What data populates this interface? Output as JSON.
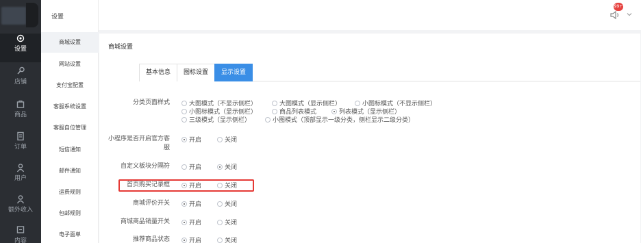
{
  "rail": {
    "items": [
      {
        "label": "设置",
        "icon": "gear-icon",
        "active": true
      },
      {
        "label": "店铺",
        "icon": "store-icon",
        "active": false
      },
      {
        "label": "商品",
        "icon": "bag-icon",
        "active": false
      },
      {
        "label": "订单",
        "icon": "order-icon",
        "active": false
      },
      {
        "label": "用户",
        "icon": "user-icon",
        "active": false
      },
      {
        "label": "额外收入",
        "icon": "income-icon",
        "active": false
      },
      {
        "label": "内容",
        "icon": "content-icon",
        "active": false
      }
    ]
  },
  "menu": {
    "header": "设置",
    "items": [
      {
        "label": "商城设置",
        "active": true
      },
      {
        "label": "网站设置",
        "active": false
      },
      {
        "label": "支付宝配置",
        "active": false
      },
      {
        "label": "客服系统设置",
        "active": false
      },
      {
        "label": "客服自位管理",
        "active": false
      },
      {
        "label": "短信通知",
        "active": false
      },
      {
        "label": "邮件通知",
        "active": false
      },
      {
        "label": "运费规则",
        "active": false
      },
      {
        "label": "包邮规则",
        "active": false
      },
      {
        "label": "电子面单",
        "active": false
      }
    ]
  },
  "topbar": {
    "badge": "99+"
  },
  "card": {
    "title": "商城设置",
    "tabs": [
      {
        "label": "基本信息",
        "active": false
      },
      {
        "label": "图标设置",
        "active": false
      },
      {
        "label": "显示设置",
        "active": true
      }
    ]
  },
  "settings": {
    "category_style": {
      "label": "分类页面样式",
      "options": [
        {
          "label": "大图模式（不显示侧栏）",
          "checked": false
        },
        {
          "label": "大图模式（显示侧栏）",
          "checked": false
        },
        {
          "label": "小图标模式（不显示侧栏）",
          "checked": false
        },
        {
          "label": "小图标模式（显示侧栏）",
          "checked": false
        },
        {
          "label": "商品列表模式",
          "checked": false
        },
        {
          "label": "列表模式（显示侧栏）",
          "checked": true
        },
        {
          "label": "三级模式（显示侧栏）",
          "checked": false
        },
        {
          "label": "小图模式（顶部显示一级分类，侧栏显示二级分类）",
          "checked": false
        }
      ]
    },
    "mini_service": {
      "label_line1": "小程序是否开启官方客",
      "label_line2": "服",
      "on": "开启",
      "off": "关闭",
      "value": "on"
    },
    "custom_block": {
      "label": "自定义板块分隔符",
      "on": "开启",
      "off": "关闭",
      "value": "off"
    },
    "home_purchase": {
      "label": "首页购买记录框",
      "on": "开启",
      "off": "关闭",
      "value": "on"
    },
    "review_switch": {
      "label": "商城评价开关",
      "on": "开启",
      "off": "关闭",
      "value": "on"
    },
    "sales_switch": {
      "label": "商城商品销量开关",
      "on": "开启",
      "off": "关闭",
      "value": "on"
    },
    "recommend_status": {
      "label": "推荐商品状态",
      "on": "开启",
      "off": "关闭",
      "value": "on"
    }
  }
}
